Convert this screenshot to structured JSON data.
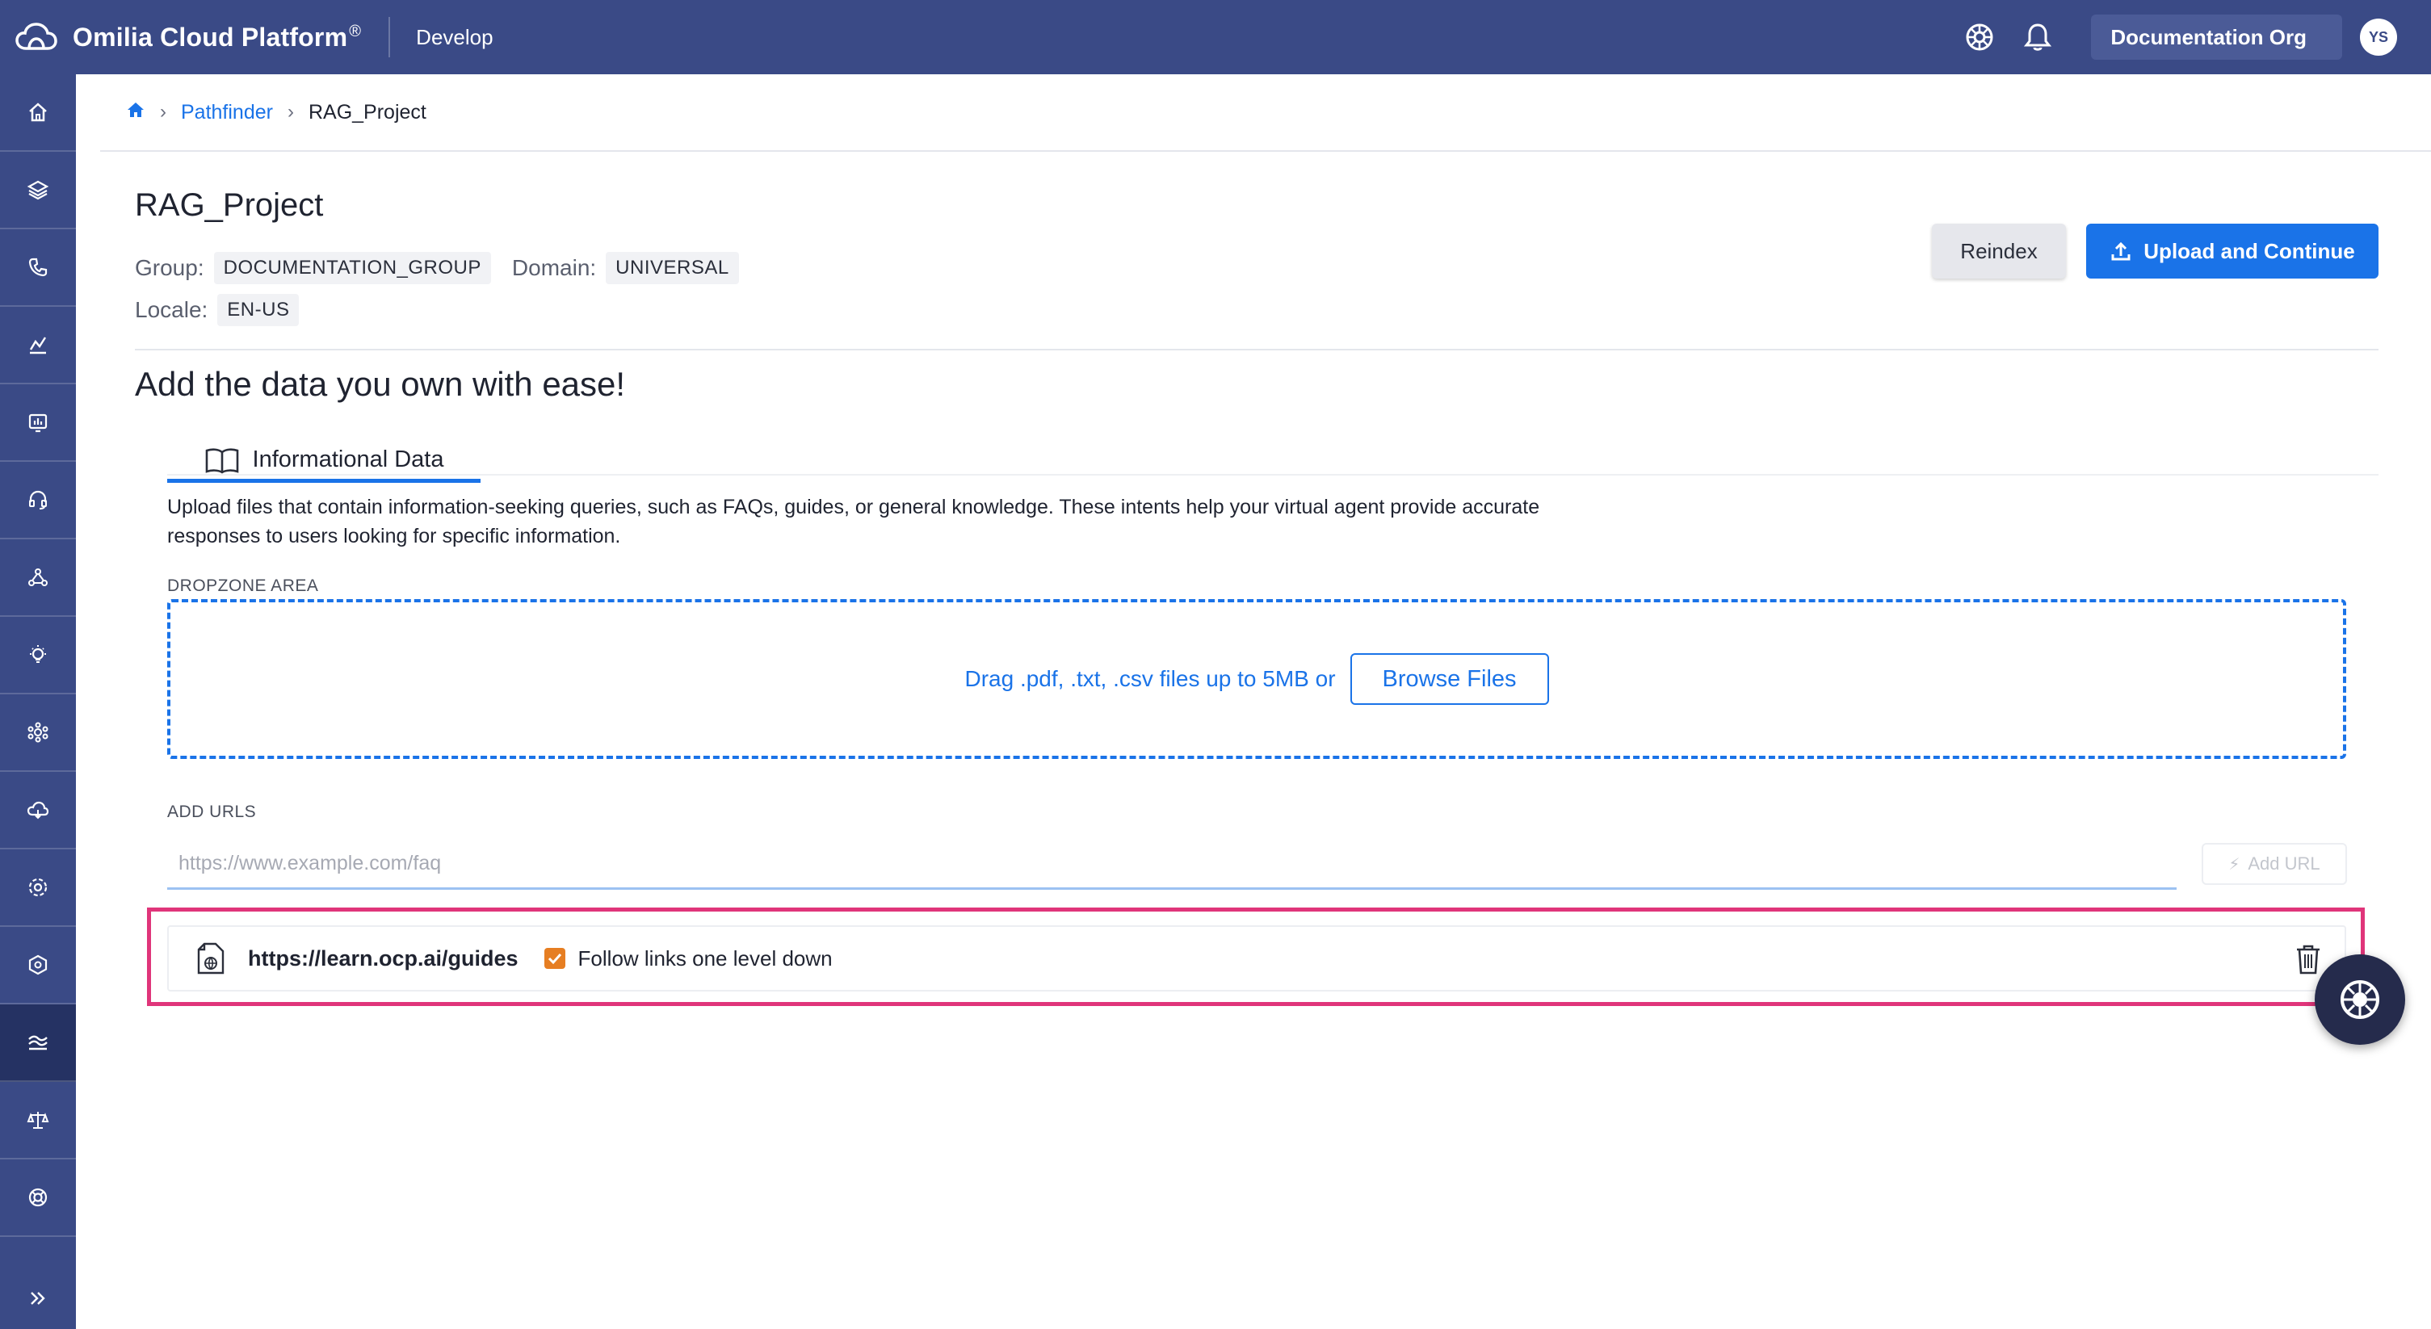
{
  "app": {
    "brand": "Omilia Cloud Platform",
    "brand_mark": "®",
    "section": "Develop",
    "org": "Documentation Org",
    "user_initials": "YS"
  },
  "sidebar": {
    "items": [
      {
        "icon": "home-icon"
      },
      {
        "icon": "layers-icon"
      },
      {
        "icon": "phone-icon"
      },
      {
        "icon": "analytics-icon"
      },
      {
        "icon": "dashboard-icon"
      },
      {
        "icon": "headset-icon"
      },
      {
        "icon": "network-icon"
      },
      {
        "icon": "lightbulb-icon"
      },
      {
        "icon": "cluster-icon"
      },
      {
        "icon": "cloud-icon"
      },
      {
        "icon": "gear-icon"
      },
      {
        "icon": "hexagon-settings-icon"
      },
      {
        "icon": "pathfinder-icon",
        "active": true
      },
      {
        "icon": "scale-icon"
      },
      {
        "icon": "support-icon"
      }
    ],
    "expand_icon": "double-chevron-right-icon"
  },
  "breadcrumb": {
    "home_icon": "home-icon",
    "items": [
      "Pathfinder",
      "RAG_Project"
    ]
  },
  "project": {
    "title": "RAG_Project",
    "group_label": "Group:",
    "group_value": "DOCUMENTATION_GROUP",
    "domain_label": "Domain:",
    "domain_value": "UNIVERSAL",
    "locale_label": "Locale:",
    "locale_value": "EN-US"
  },
  "actions": {
    "reindex_label": "Reindex",
    "upload_label": "Upload and Continue"
  },
  "main": {
    "heading": "Add the data you own with ease!",
    "tab_label": "Informational Data",
    "description": "Upload files that contain information-seeking queries, such as FAQs, guides, or general knowledge. These intents help your virtual agent provide accurate responses to users looking for specific information.",
    "dropzone_label": "DROPZONE AREA",
    "dropzone_text": "Drag .pdf, .txt, .csv files up to 5MB or",
    "browse_label": "Browse Files",
    "urls_label": "ADD URLS",
    "url_placeholder": "https://www.example.com/faq",
    "add_url_label": "Add URL",
    "url_entries": [
      {
        "url": "https://learn.ocp.ai/guides",
        "follow_label": "Follow links one level down",
        "follow_checked": true
      }
    ]
  },
  "colors": {
    "nav_bg": "#3a4a86",
    "accent": "#1a73e8",
    "highlight": "#e0357a",
    "checkbox": "#e67e22"
  }
}
